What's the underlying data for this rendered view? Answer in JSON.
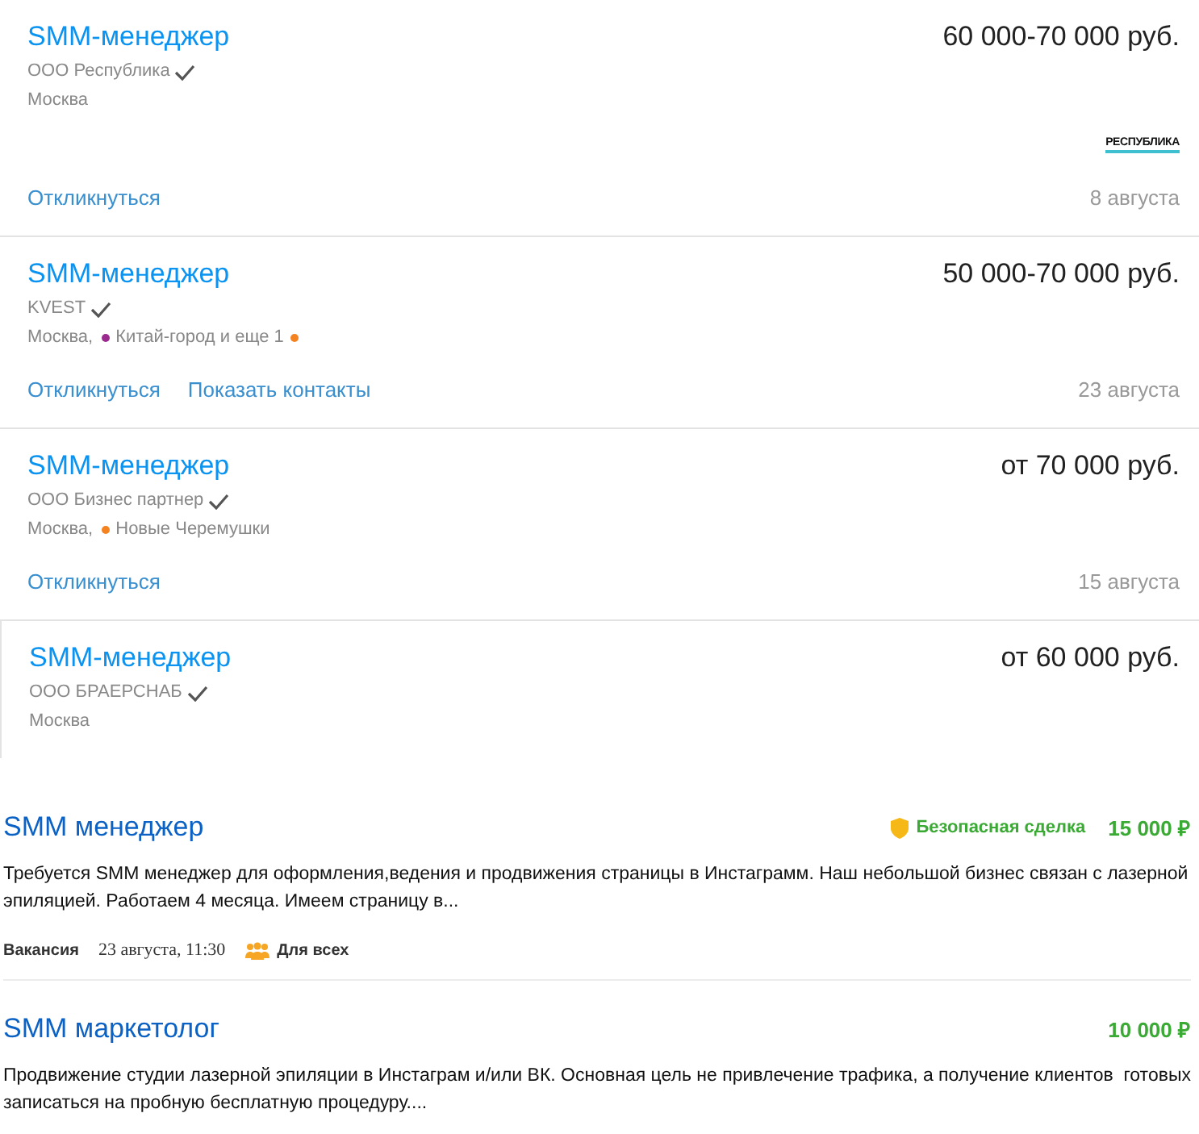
{
  "vacancies": [
    {
      "title": "SMM-менеджер",
      "company": "ООО Республика",
      "verified": true,
      "city": "Москва",
      "logo": "РЕСПУБЛИКА",
      "salary": "60 000-70 000 руб.",
      "actions": [
        "Откликнуться"
      ],
      "date": "8 августа"
    },
    {
      "title": "SMM-менеджер",
      "company": "KVEST",
      "verified": true,
      "city": "Москва,",
      "stations": [
        {
          "color": "#9b2a8f",
          "name": "Китай-город и еще 1"
        },
        {
          "color": "#f58220"
        }
      ],
      "salary": "50 000-70 000 руб.",
      "actions": [
        "Откликнуться",
        "Показать контакты"
      ],
      "date": "23 августа"
    },
    {
      "title": "SMM-менеджер",
      "company": "ООО Бизнес партнер",
      "verified": true,
      "city": "Москва,",
      "stations": [
        {
          "color": "#f58220",
          "name": "Новые Черемушки"
        }
      ],
      "salary": "от 70 000 руб.",
      "actions": [
        "Откликнуться"
      ],
      "date": "15 августа"
    },
    {
      "title": "SMM-менеджер",
      "company": "ООО БРАЕРСНАБ",
      "verified": true,
      "city": "Москва",
      "salary": "от 60 000 руб."
    }
  ],
  "tasks": [
    {
      "title": "SMM менеджер",
      "safe_deal": "Безопасная сделка",
      "price": "15 000 ₽",
      "description": "Требуется SMM менеджер для оформления,ведения и продвижения страницы в Инстаграмм. Наш небольшой бизнес связан с лазерной эпиляцией. Работаем 4 месяца. Имеем страницу в...",
      "type": "Вакансия",
      "datetime": "23 августа, 11:30",
      "audience": "Для всех"
    },
    {
      "title": "SMM маркетолог",
      "price": "10 000 ₽",
      "description": "Продвижение студии лазерной эпиляции в Инстаграм и/или ВК. Основная цель не привлечение трафика, а получение клиентов  готовых записаться на пробную бесплатную процедуру...."
    }
  ]
}
